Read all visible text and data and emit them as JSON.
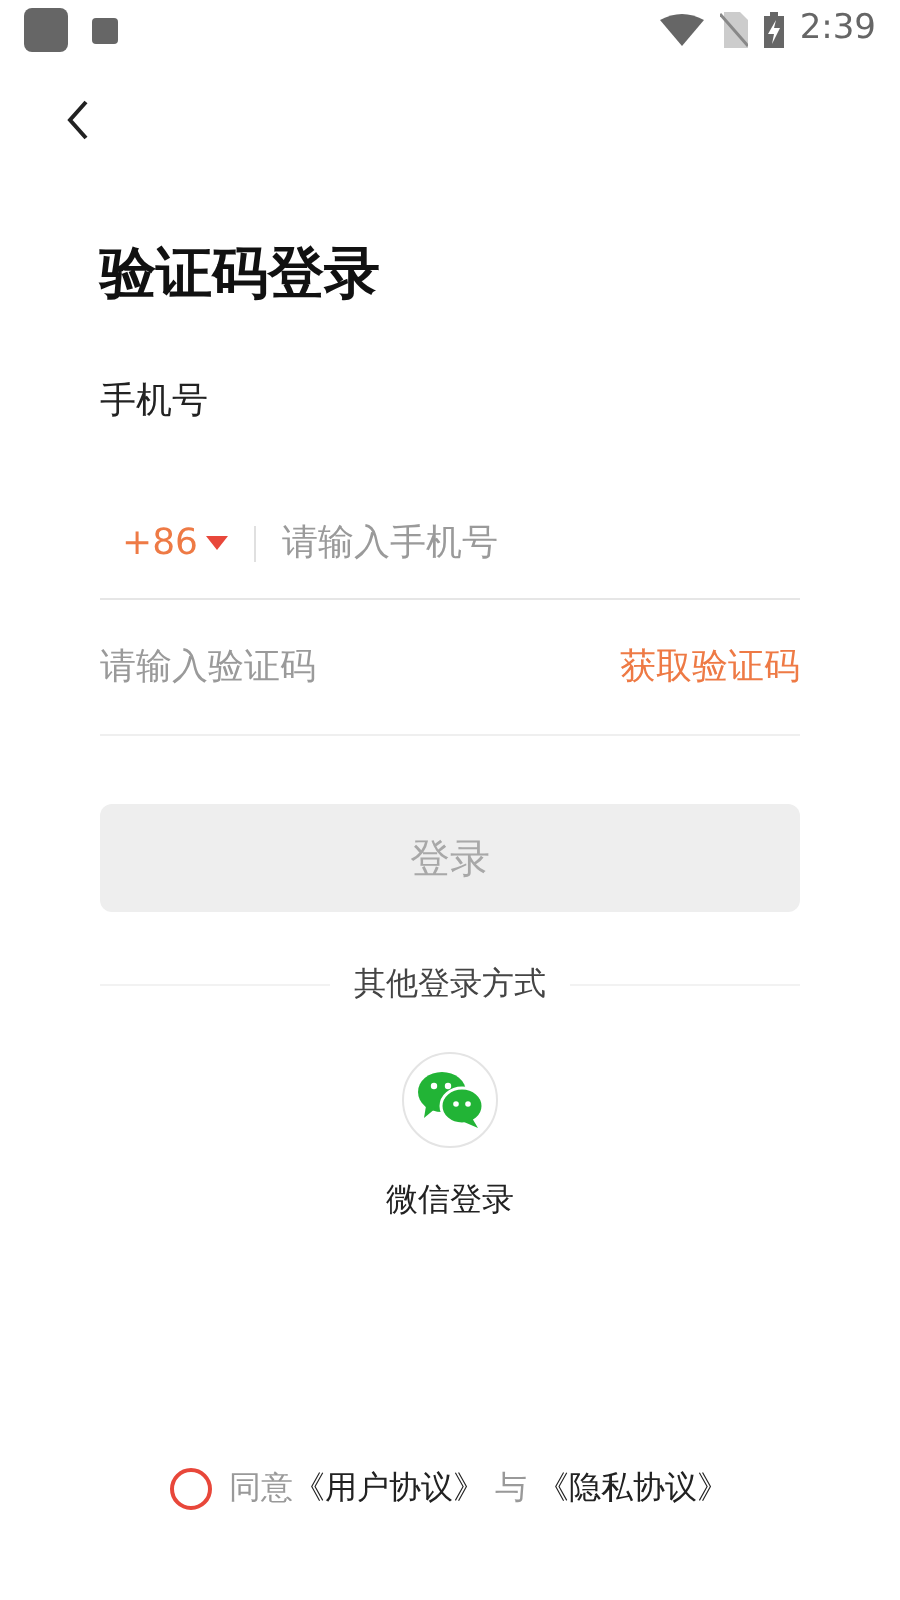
{
  "status_bar": {
    "time": "2:39"
  },
  "title": "验证码登录",
  "phone": {
    "label": "手机号",
    "country_code": "+86",
    "placeholder": "请输入手机号"
  },
  "code": {
    "placeholder": "请输入验证码",
    "action": "获取验证码"
  },
  "login_button": {
    "label": "登录",
    "disabled": true
  },
  "other_login": {
    "heading": "其他登录方式",
    "options": [
      {
        "kind": "wechat",
        "label": "微信登录"
      }
    ]
  },
  "agreement": {
    "checked": false,
    "parts": [
      {
        "kind": "plain",
        "text": "同意"
      },
      {
        "kind": "link",
        "text": "《用户协议》"
      },
      {
        "kind": "plain",
        "text": "与"
      },
      {
        "kind": "link",
        "text": "《隐私协议》"
      }
    ]
  }
}
